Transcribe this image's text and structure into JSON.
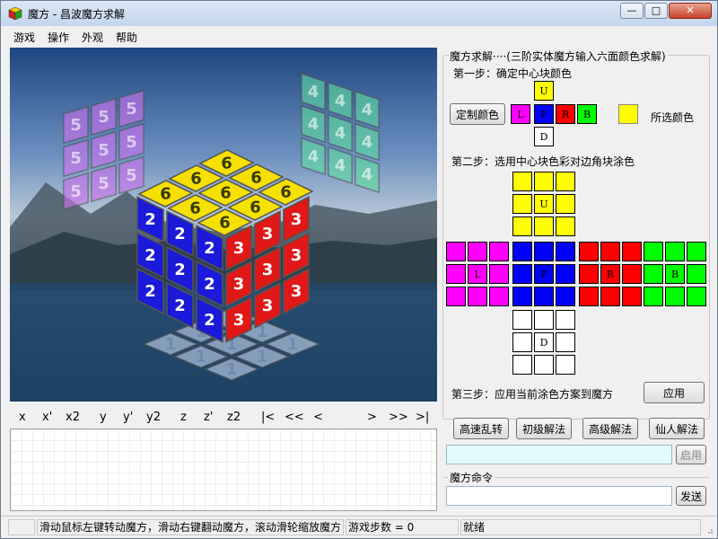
{
  "window": {
    "title": "魔方 - 昌波魔方求解",
    "min": "—",
    "max": "□",
    "close": "✕"
  },
  "menu": [
    "游戏",
    "操作",
    "外观",
    "帮助"
  ],
  "rotation_controls": [
    "x",
    "x'",
    "x2",
    "y",
    "y'",
    "y2",
    "z",
    "z'",
    "z2",
    "|<",
    "<<",
    "<",
    ">",
    ">>",
    ">|"
  ],
  "solver": {
    "group_title": "魔方求解····(三阶实体魔方输入六面颜色求解)",
    "step1": "第一步：确定中心块颜色",
    "custom_color_button": "定制颜色",
    "selected_color_label": "所选颜色",
    "selected_color": "#ffff00",
    "center_colors": [
      {
        "label": "U",
        "color": "#ffff00"
      },
      {
        "label": "L",
        "color": "#ff00ff"
      },
      {
        "label": "F",
        "color": "#0000ff"
      },
      {
        "label": "R",
        "color": "#ff0000"
      },
      {
        "label": "B",
        "color": "#00ff00"
      },
      {
        "label": "D",
        "color": "#ffffff"
      }
    ],
    "step2": "第二步：选用中心块色彩对边角块涂色",
    "net_faces": [
      {
        "face": "U",
        "label": "U",
        "color": "#ffff00"
      },
      {
        "face": "L",
        "label": "L",
        "color": "#ff00ff"
      },
      {
        "face": "F",
        "label": "F",
        "color": "#0000ff"
      },
      {
        "face": "R",
        "label": "R",
        "color": "#ff0000"
      },
      {
        "face": "B",
        "label": "B",
        "color": "#00ff00"
      },
      {
        "face": "D",
        "label": "D",
        "color": "#ffffff"
      }
    ],
    "step3": "第三步：应用当前涂色方案到魔方",
    "apply_button": "应用"
  },
  "actions": {
    "scramble": "高速乱转",
    "basic_solve": "初级解法",
    "advanced_solve": "高级解法",
    "fairy_solve": "仙人解法",
    "enable": "启用"
  },
  "command": {
    "group_title": "魔方命令",
    "send": "发送",
    "value": ""
  },
  "status": {
    "hint": "滑动鼠标左键转动魔方，滑动右键翻动魔方，滚动滑轮缩放魔方",
    "steps": "游戏步数 = 0",
    "state": "就绪"
  },
  "cube": {
    "top_label": "6",
    "front_label": "2",
    "right_label": "3",
    "left_ghost_label": "5",
    "right_ghost_label": "4",
    "bottom_ghost_label": "1",
    "colors": {
      "top": "#f5e000",
      "front": "#1a1ad8",
      "right": "#e01818",
      "left_ghost": "#d070f0",
      "right_ghost": "#60e0a0",
      "bottom_ghost": "#c8d8f0"
    }
  }
}
